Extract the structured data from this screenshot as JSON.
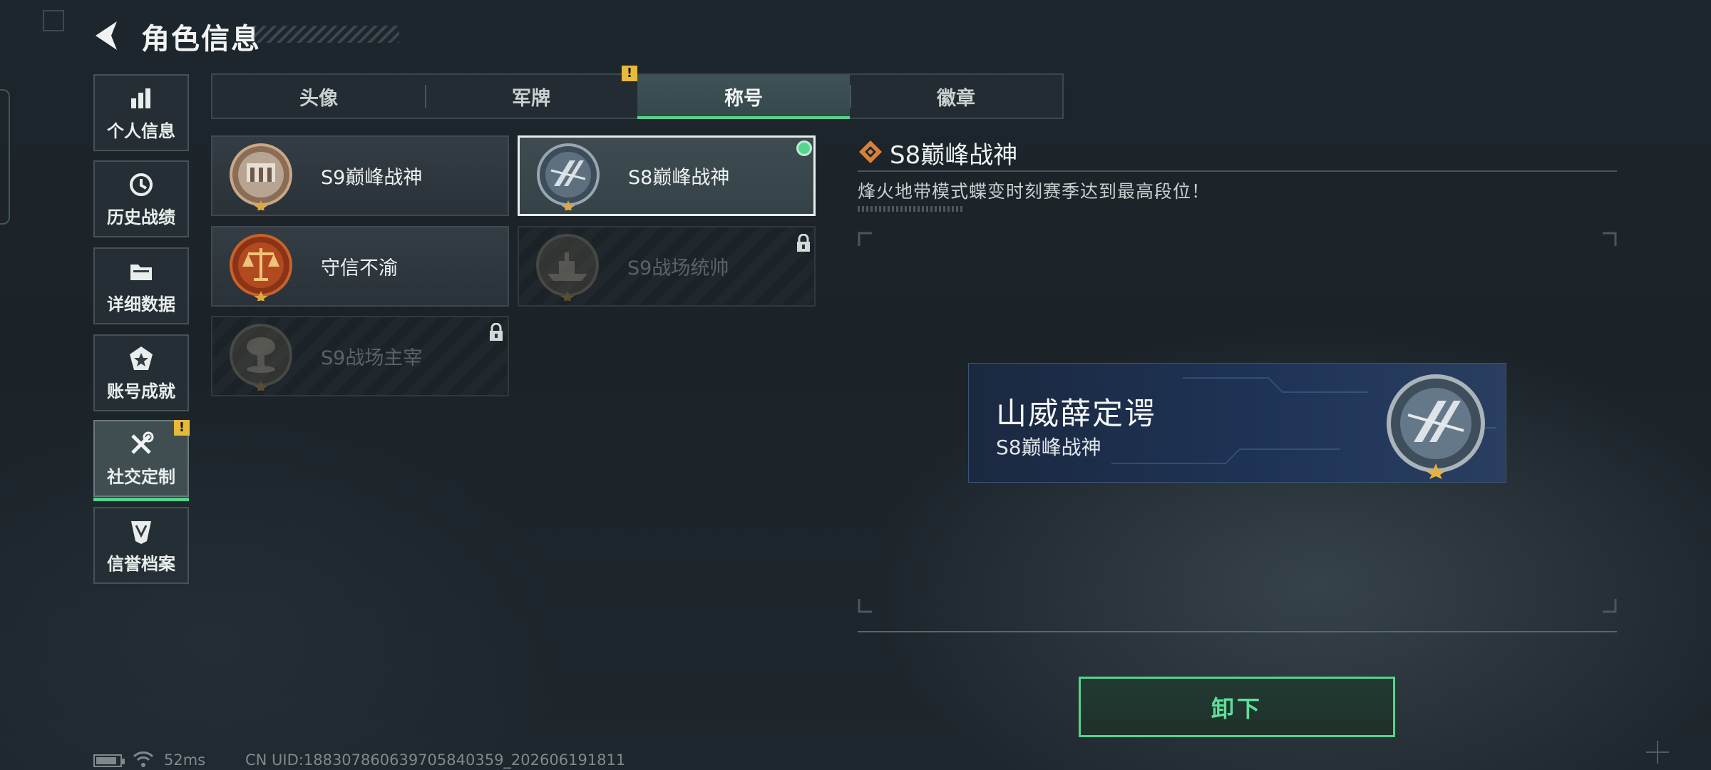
{
  "header": {
    "title": "角色信息"
  },
  "menu": {
    "items": [
      {
        "label": "个人信息",
        "icon": "bar-chart-icon"
      },
      {
        "label": "历史战绩",
        "icon": "history-clock-icon"
      },
      {
        "label": "详细数据",
        "icon": "folder-icon"
      },
      {
        "label": "账号成就",
        "icon": "achievement-star-icon"
      },
      {
        "label": "社交定制",
        "icon": "tools-icon",
        "active": true,
        "badge": "!"
      },
      {
        "label": "信誉档案",
        "icon": "credit-shield-icon"
      }
    ]
  },
  "tabs": {
    "items": [
      {
        "label": "头像"
      },
      {
        "label": "军牌",
        "badge": "!"
      },
      {
        "label": "称号",
        "active": true
      },
      {
        "label": "徽章"
      }
    ]
  },
  "titles": [
    {
      "label": "S9巅峰战神",
      "state": "unlocked",
      "icon": "arch-medal-icon"
    },
    {
      "label": "S8巅峰战神",
      "state": "equipped",
      "selected": true,
      "icon": "wing-medal-icon"
    },
    {
      "label": "守信不渝",
      "state": "unlocked",
      "icon": "scales-medal-icon"
    },
    {
      "label": "S9战场统帅",
      "state": "locked",
      "icon": "warship-medal-icon"
    },
    {
      "label": "S9战场主宰",
      "state": "locked",
      "icon": "mushroom-cloud-medal-icon"
    }
  ],
  "detail": {
    "title": "S8巅峰战神",
    "description": "烽火地带模式蝶变时刻赛季达到最高段位！",
    "preview": {
      "player_name": "山威薛定谔",
      "title": "S8巅峰战神"
    },
    "button_label": "卸下"
  },
  "status": {
    "ping": "52ms",
    "uid": "CN UID:1883078606397058403​59_202606191811"
  },
  "colors": {
    "accent_green": "#55d38c",
    "warning_yellow": "#e7b93c",
    "banner_blue": "#1e3356"
  }
}
